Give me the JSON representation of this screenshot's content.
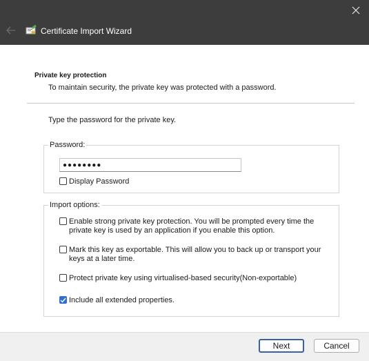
{
  "window": {
    "title": "Certificate Import Wizard",
    "close_icon": "close-icon",
    "back_icon": "back-arrow-icon",
    "app_icon": "certificate-icon"
  },
  "page": {
    "heading": "Private key protection",
    "subheading": "To maintain security, the private key was protected with a password.",
    "prompt": "Type the password for the private key."
  },
  "password_group": {
    "legend": "Password:",
    "value": "●●●●●●●●",
    "display_password_label": "Display Password",
    "display_password_checked": false
  },
  "import_options": {
    "legend": "Import options:",
    "options": [
      {
        "label": "Enable strong private key protection. You will be prompted every time the private key is used by an application if you enable this option.",
        "checked": false
      },
      {
        "label": "Mark this key as exportable. This will allow you to back up or transport your keys at a later time.",
        "checked": false
      },
      {
        "label": "Protect private key using virtualised-based security(Non-exportable)",
        "checked": false
      },
      {
        "label": "Include all extended properties.",
        "checked": true
      }
    ]
  },
  "footer": {
    "next_label": "Next",
    "cancel_label": "Cancel"
  },
  "colors": {
    "titlebar": "#3d3d3d",
    "accent": "#2e6fd1"
  }
}
